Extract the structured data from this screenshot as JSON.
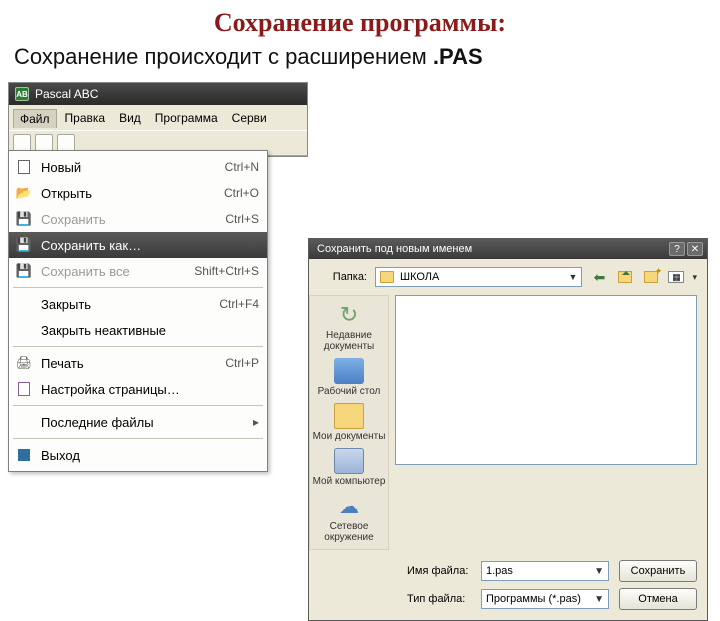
{
  "slide": {
    "title": "Сохранение программы:",
    "subtitle_prefix": "Сохранение происходит с расширением ",
    "subtitle_ext": ".PAS"
  },
  "pascal": {
    "app_title": "Pascal ABC",
    "menubar": [
      "Файл",
      "Правка",
      "Вид",
      "Программа",
      "Серви"
    ],
    "menu": {
      "new": {
        "label": "Новый",
        "shortcut": "Ctrl+N"
      },
      "open": {
        "label": "Открыть",
        "shortcut": "Ctrl+O"
      },
      "save": {
        "label": "Сохранить",
        "shortcut": "Ctrl+S"
      },
      "saveas": {
        "label": "Сохранить как…",
        "shortcut": ""
      },
      "saveall": {
        "label": "Сохранить все",
        "shortcut": "Shift+Ctrl+S"
      },
      "close": {
        "label": "Закрыть",
        "shortcut": "Ctrl+F4"
      },
      "close_inact": {
        "label": "Закрыть неактивные",
        "shortcut": ""
      },
      "print": {
        "label": "Печать",
        "shortcut": "Ctrl+P"
      },
      "page_setup": {
        "label": "Настройка страницы…",
        "shortcut": ""
      },
      "recent": {
        "label": "Последние файлы",
        "shortcut": ""
      },
      "exit": {
        "label": "Выход",
        "shortcut": ""
      }
    }
  },
  "save_dialog": {
    "title": "Сохранить под новым именем",
    "folder_label": "Папка:",
    "folder_value": "ШКОЛА",
    "places": {
      "recent": "Недавние документы",
      "desktop": "Рабочий стол",
      "mydocs": "Мои документы",
      "mycomp": "Мой компьютер",
      "network": "Сетевое окружение"
    },
    "filename_label": "Имя файла:",
    "filename_value": "1.pas",
    "filetype_label": "Тип файла:",
    "filetype_value": "Программы (*.pas)",
    "btn_save": "Сохранить",
    "btn_cancel": "Отмена"
  }
}
